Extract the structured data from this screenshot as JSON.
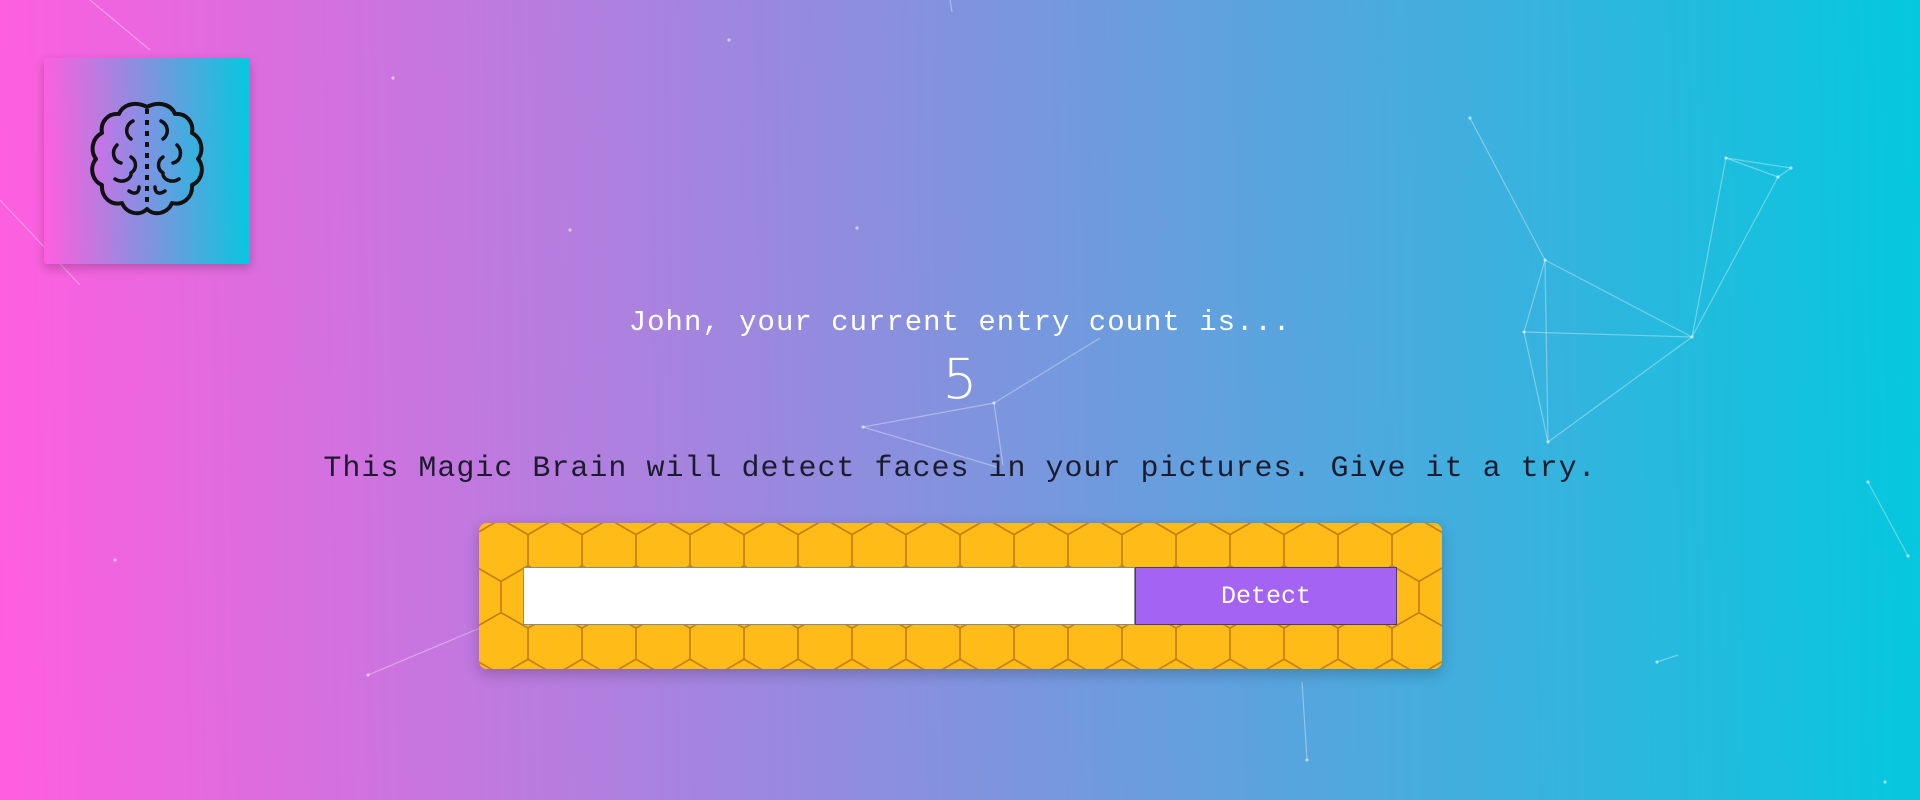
{
  "rank": {
    "message": "John, your current entry count is...",
    "count": "5"
  },
  "intro_text": "This Magic Brain will detect faces in your pictures. Give it a try.",
  "image_form": {
    "url_value": "",
    "url_placeholder": "",
    "detect_label": "Detect"
  },
  "logo": {
    "icon": "brain-icon"
  },
  "colors": {
    "gradient_start": "#ff5edf",
    "gradient_end": "#04c8de",
    "form_panel": "#ffbb17",
    "detect_button": "#a463f2",
    "rank_text": "#ffffff",
    "intro_text": "#1c1c2e"
  }
}
